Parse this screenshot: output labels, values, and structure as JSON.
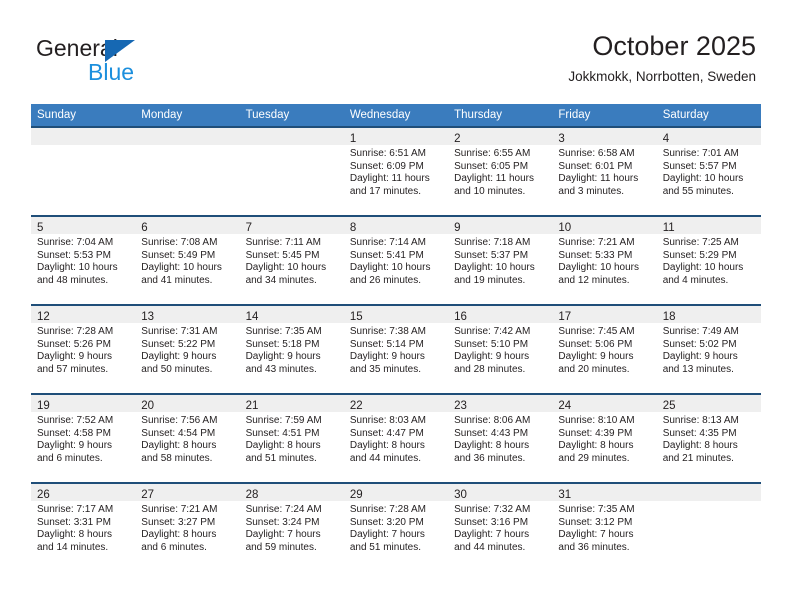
{
  "brand": {
    "name_part1": "General",
    "name_part2": "Blue",
    "logo_icon": "triangle-logo-icon",
    "accent_color": "#1668b3",
    "blue_text_color": "#1c8fdd"
  },
  "header": {
    "title": "October 2025",
    "subtitle": "Jokkmokk, Norrbotten, Sweden"
  },
  "theme": {
    "header_row_bg": "#3a7cbe",
    "row_top_border": "#1f4e79",
    "daynum_strip_bg": "#efefef",
    "text_color": "#231f20"
  },
  "weekday_headers": [
    "Sunday",
    "Monday",
    "Tuesday",
    "Wednesday",
    "Thursday",
    "Friday",
    "Saturday"
  ],
  "labels": {
    "sunrise_prefix": "Sunrise:",
    "sunset_prefix": "Sunset:",
    "daylight_prefix": "Daylight:"
  },
  "weeks": [
    [
      {
        "day": "",
        "line1": "",
        "line2": "",
        "line3": "",
        "line4": "",
        "empty": true
      },
      {
        "day": "",
        "line1": "",
        "line2": "",
        "line3": "",
        "line4": "",
        "empty": true
      },
      {
        "day": "",
        "line1": "",
        "line2": "",
        "line3": "",
        "line4": "",
        "empty": true
      },
      {
        "day": "1",
        "line1": "Sunrise: 6:51 AM",
        "line2": "Sunset: 6:09 PM",
        "line3": "Daylight: 11 hours",
        "line4": "and 17 minutes.",
        "empty": false
      },
      {
        "day": "2",
        "line1": "Sunrise: 6:55 AM",
        "line2": "Sunset: 6:05 PM",
        "line3": "Daylight: 11 hours",
        "line4": "and 10 minutes.",
        "empty": false
      },
      {
        "day": "3",
        "line1": "Sunrise: 6:58 AM",
        "line2": "Sunset: 6:01 PM",
        "line3": "Daylight: 11 hours",
        "line4": "and 3 minutes.",
        "empty": false
      },
      {
        "day": "4",
        "line1": "Sunrise: 7:01 AM",
        "line2": "Sunset: 5:57 PM",
        "line3": "Daylight: 10 hours",
        "line4": "and 55 minutes.",
        "empty": false
      }
    ],
    [
      {
        "day": "5",
        "line1": "Sunrise: 7:04 AM",
        "line2": "Sunset: 5:53 PM",
        "line3": "Daylight: 10 hours",
        "line4": "and 48 minutes.",
        "empty": false
      },
      {
        "day": "6",
        "line1": "Sunrise: 7:08 AM",
        "line2": "Sunset: 5:49 PM",
        "line3": "Daylight: 10 hours",
        "line4": "and 41 minutes.",
        "empty": false
      },
      {
        "day": "7",
        "line1": "Sunrise: 7:11 AM",
        "line2": "Sunset: 5:45 PM",
        "line3": "Daylight: 10 hours",
        "line4": "and 34 minutes.",
        "empty": false
      },
      {
        "day": "8",
        "line1": "Sunrise: 7:14 AM",
        "line2": "Sunset: 5:41 PM",
        "line3": "Daylight: 10 hours",
        "line4": "and 26 minutes.",
        "empty": false
      },
      {
        "day": "9",
        "line1": "Sunrise: 7:18 AM",
        "line2": "Sunset: 5:37 PM",
        "line3": "Daylight: 10 hours",
        "line4": "and 19 minutes.",
        "empty": false
      },
      {
        "day": "10",
        "line1": "Sunrise: 7:21 AM",
        "line2": "Sunset: 5:33 PM",
        "line3": "Daylight: 10 hours",
        "line4": "and 12 minutes.",
        "empty": false
      },
      {
        "day": "11",
        "line1": "Sunrise: 7:25 AM",
        "line2": "Sunset: 5:29 PM",
        "line3": "Daylight: 10 hours",
        "line4": "and 4 minutes.",
        "empty": false
      }
    ],
    [
      {
        "day": "12",
        "line1": "Sunrise: 7:28 AM",
        "line2": "Sunset: 5:26 PM",
        "line3": "Daylight: 9 hours",
        "line4": "and 57 minutes.",
        "empty": false
      },
      {
        "day": "13",
        "line1": "Sunrise: 7:31 AM",
        "line2": "Sunset: 5:22 PM",
        "line3": "Daylight: 9 hours",
        "line4": "and 50 minutes.",
        "empty": false
      },
      {
        "day": "14",
        "line1": "Sunrise: 7:35 AM",
        "line2": "Sunset: 5:18 PM",
        "line3": "Daylight: 9 hours",
        "line4": "and 43 minutes.",
        "empty": false
      },
      {
        "day": "15",
        "line1": "Sunrise: 7:38 AM",
        "line2": "Sunset: 5:14 PM",
        "line3": "Daylight: 9 hours",
        "line4": "and 35 minutes.",
        "empty": false
      },
      {
        "day": "16",
        "line1": "Sunrise: 7:42 AM",
        "line2": "Sunset: 5:10 PM",
        "line3": "Daylight: 9 hours",
        "line4": "and 28 minutes.",
        "empty": false
      },
      {
        "day": "17",
        "line1": "Sunrise: 7:45 AM",
        "line2": "Sunset: 5:06 PM",
        "line3": "Daylight: 9 hours",
        "line4": "and 20 minutes.",
        "empty": false
      },
      {
        "day": "18",
        "line1": "Sunrise: 7:49 AM",
        "line2": "Sunset: 5:02 PM",
        "line3": "Daylight: 9 hours",
        "line4": "and 13 minutes.",
        "empty": false
      }
    ],
    [
      {
        "day": "19",
        "line1": "Sunrise: 7:52 AM",
        "line2": "Sunset: 4:58 PM",
        "line3": "Daylight: 9 hours",
        "line4": "and 6 minutes.",
        "empty": false
      },
      {
        "day": "20",
        "line1": "Sunrise: 7:56 AM",
        "line2": "Sunset: 4:54 PM",
        "line3": "Daylight: 8 hours",
        "line4": "and 58 minutes.",
        "empty": false
      },
      {
        "day": "21",
        "line1": "Sunrise: 7:59 AM",
        "line2": "Sunset: 4:51 PM",
        "line3": "Daylight: 8 hours",
        "line4": "and 51 minutes.",
        "empty": false
      },
      {
        "day": "22",
        "line1": "Sunrise: 8:03 AM",
        "line2": "Sunset: 4:47 PM",
        "line3": "Daylight: 8 hours",
        "line4": "and 44 minutes.",
        "empty": false
      },
      {
        "day": "23",
        "line1": "Sunrise: 8:06 AM",
        "line2": "Sunset: 4:43 PM",
        "line3": "Daylight: 8 hours",
        "line4": "and 36 minutes.",
        "empty": false
      },
      {
        "day": "24",
        "line1": "Sunrise: 8:10 AM",
        "line2": "Sunset: 4:39 PM",
        "line3": "Daylight: 8 hours",
        "line4": "and 29 minutes.",
        "empty": false
      },
      {
        "day": "25",
        "line1": "Sunrise: 8:13 AM",
        "line2": "Sunset: 4:35 PM",
        "line3": "Daylight: 8 hours",
        "line4": "and 21 minutes.",
        "empty": false
      }
    ],
    [
      {
        "day": "26",
        "line1": "Sunrise: 7:17 AM",
        "line2": "Sunset: 3:31 PM",
        "line3": "Daylight: 8 hours",
        "line4": "and 14 minutes.",
        "empty": false
      },
      {
        "day": "27",
        "line1": "Sunrise: 7:21 AM",
        "line2": "Sunset: 3:27 PM",
        "line3": "Daylight: 8 hours",
        "line4": "and 6 minutes.",
        "empty": false
      },
      {
        "day": "28",
        "line1": "Sunrise: 7:24 AM",
        "line2": "Sunset: 3:24 PM",
        "line3": "Daylight: 7 hours",
        "line4": "and 59 minutes.",
        "empty": false
      },
      {
        "day": "29",
        "line1": "Sunrise: 7:28 AM",
        "line2": "Sunset: 3:20 PM",
        "line3": "Daylight: 7 hours",
        "line4": "and 51 minutes.",
        "empty": false
      },
      {
        "day": "30",
        "line1": "Sunrise: 7:32 AM",
        "line2": "Sunset: 3:16 PM",
        "line3": "Daylight: 7 hours",
        "line4": "and 44 minutes.",
        "empty": false
      },
      {
        "day": "31",
        "line1": "Sunrise: 7:35 AM",
        "line2": "Sunset: 3:12 PM",
        "line3": "Daylight: 7 hours",
        "line4": "and 36 minutes.",
        "empty": false
      },
      {
        "day": "",
        "line1": "",
        "line2": "",
        "line3": "",
        "line4": "",
        "empty": true
      }
    ]
  ]
}
